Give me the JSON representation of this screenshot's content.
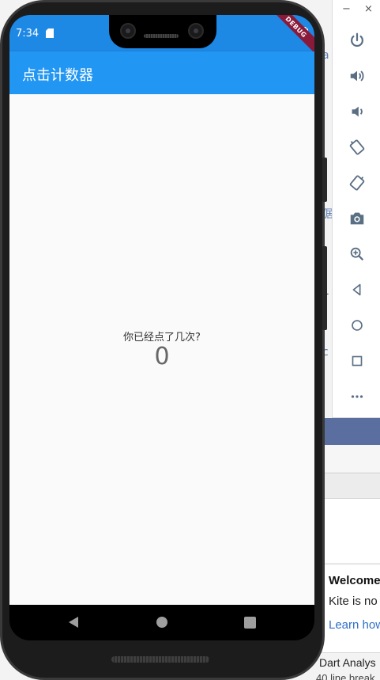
{
  "emulator_toolbar": {
    "minimize": "−",
    "close": "×",
    "tools": [
      {
        "name": "power-icon"
      },
      {
        "name": "volume-up-icon"
      },
      {
        "name": "volume-down-icon"
      },
      {
        "name": "rotate-left-icon"
      },
      {
        "name": "rotate-right-icon"
      },
      {
        "name": "camera-icon"
      },
      {
        "name": "zoom-icon"
      },
      {
        "name": "back-icon"
      },
      {
        "name": "home-icon"
      },
      {
        "name": "overview-icon"
      },
      {
        "name": "more-icon"
      }
    ]
  },
  "ide": {
    "side_fragments": [
      "a",
      "倨",
      "1",
      "c"
    ],
    "welcome_title": "Welcome",
    "welcome_body": "Kite is no",
    "welcome_link": "Learn how",
    "dart_analysis": "Dart Analys",
    "line_break": "40 line break"
  },
  "phone": {
    "status_time": "7:34",
    "debug_label": "DEBUG",
    "app_title": "点击计数器",
    "prompt": "你已经点了几次?",
    "counter": "0"
  },
  "colors": {
    "appbar": "#2196f3",
    "statusbar": "#1e88e5",
    "debug": "#8a1a3a",
    "ide_blue": "#5a6e9f"
  }
}
